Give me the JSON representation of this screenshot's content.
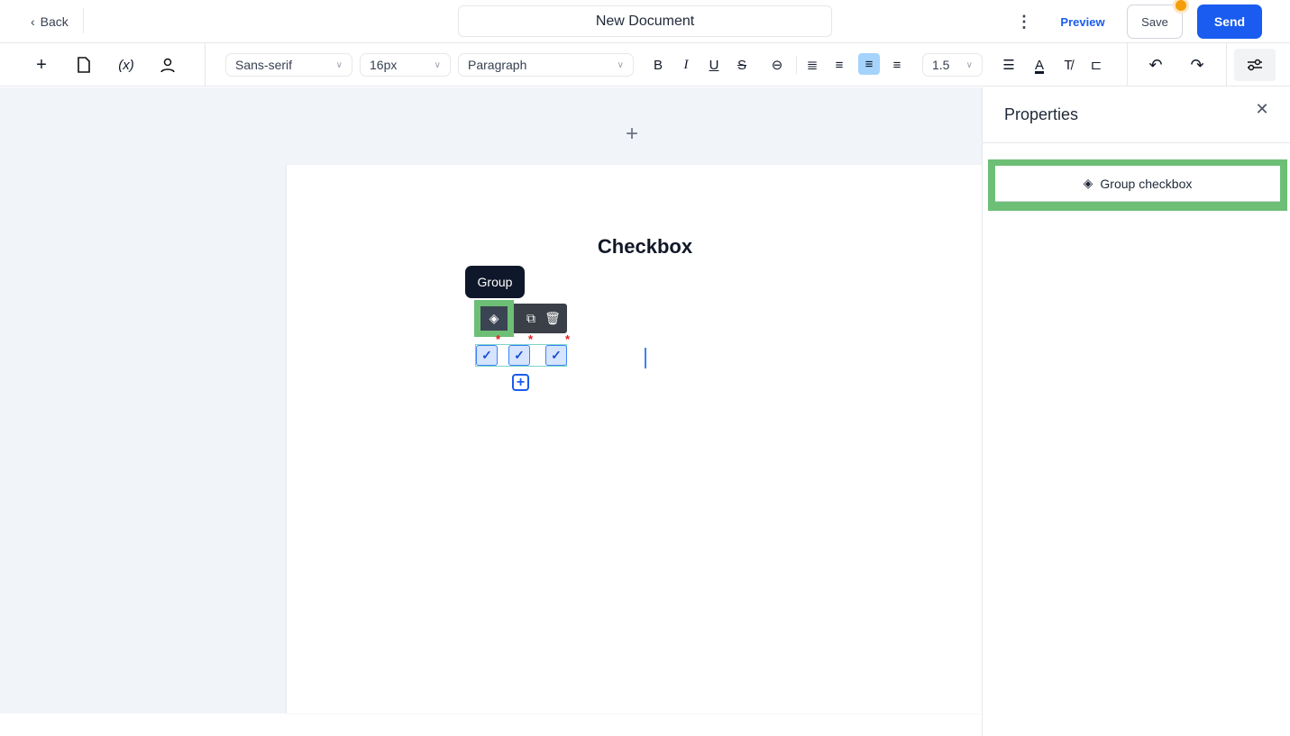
{
  "header": {
    "back": "Back",
    "title": "New Document",
    "preview": "Preview",
    "save": "Save",
    "send": "Send",
    "accent": "#1a5cf0",
    "notification_dot": "#f59e0b"
  },
  "toolbar": {
    "font": "Sans-serif",
    "size": "16px",
    "block": "Paragraph",
    "line_height": "1.5",
    "active_align": "center"
  },
  "document": {
    "heading": "Checkbox",
    "tooltip": "Group",
    "checkbox_count": 3,
    "required_mark": "*"
  },
  "properties": {
    "title": "Properties",
    "group_button": "Group checkbox"
  }
}
